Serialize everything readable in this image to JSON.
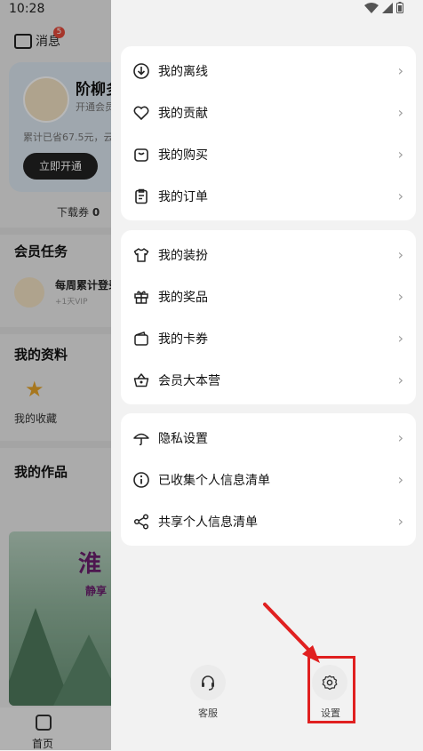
{
  "status_bar": {
    "time": "10:28"
  },
  "background": {
    "messages_label": "消息",
    "messages_badge": "5",
    "username": "阶柳多",
    "vip_subtitle": "开通会员",
    "saved_text": "累计已省67.5元，云",
    "open_button": "立即开通",
    "coupon_label": "下载券",
    "coupon_count": "0",
    "tasks_title": "会员任务",
    "task_title": "每周累计登录",
    "task_reward": "+1天VIP",
    "profile_title": "我的资料",
    "favorites_label": "我的收藏",
    "works_title": "我的作品",
    "poster_title": "淮",
    "poster_subtitle": "静享",
    "nav_home": "首页"
  },
  "drawer": {
    "groups": [
      {
        "items": [
          {
            "icon": "download-icon",
            "label": "我的离线"
          },
          {
            "icon": "heart-icon",
            "label": "我的贡献"
          },
          {
            "icon": "bag-icon",
            "label": "我的购买"
          },
          {
            "icon": "clipboard-icon",
            "label": "我的订单"
          }
        ]
      },
      {
        "items": [
          {
            "icon": "shirt-icon",
            "label": "我的装扮"
          },
          {
            "icon": "gift-icon",
            "label": "我的奖品"
          },
          {
            "icon": "wallet-icon",
            "label": "我的卡券"
          },
          {
            "icon": "basket-icon",
            "label": "会员大本营"
          }
        ]
      },
      {
        "items": [
          {
            "icon": "umbrella-icon",
            "label": "隐私设置"
          },
          {
            "icon": "info-icon",
            "label": "已收集个人信息清单"
          },
          {
            "icon": "share-icon",
            "label": "共享个人信息清单"
          }
        ]
      }
    ],
    "customer_service_label": "客服",
    "settings_label": "设置"
  },
  "colors": {
    "accent_red": "#e02020",
    "badge_red": "#e74c3c",
    "star": "#e8a62a"
  }
}
